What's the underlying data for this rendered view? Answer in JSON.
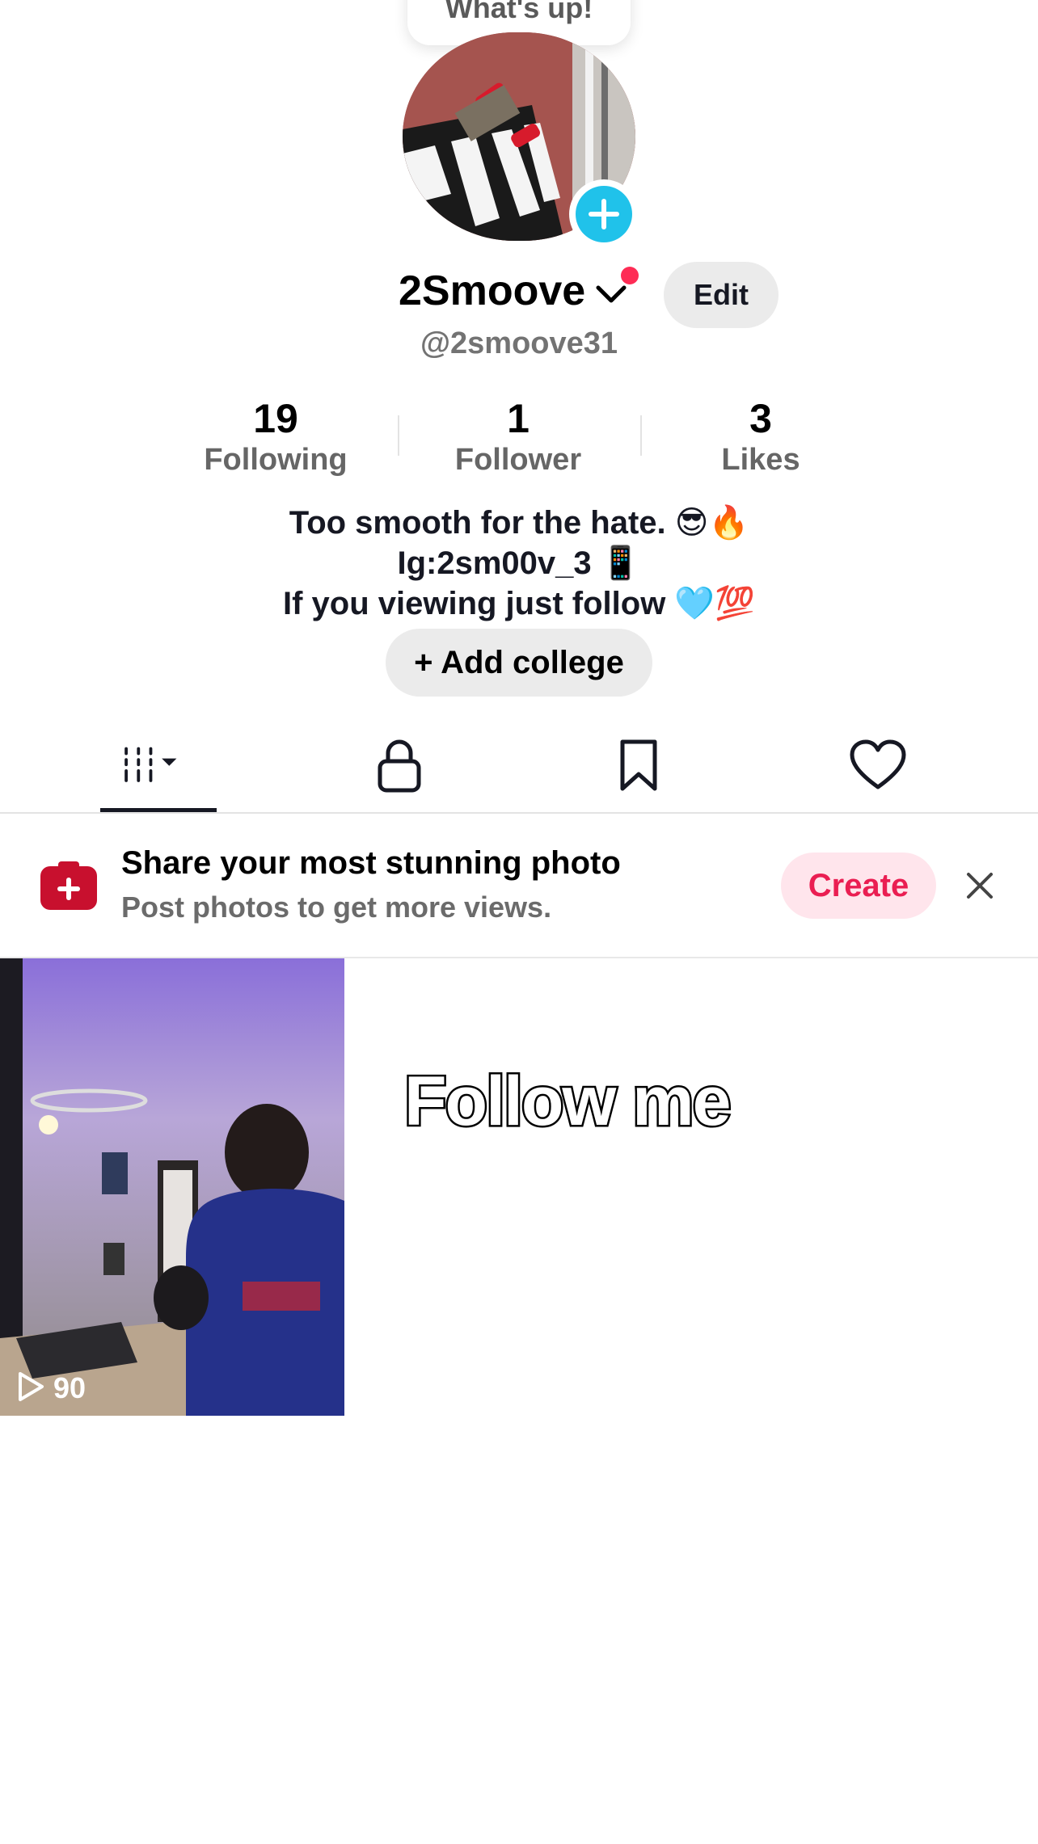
{
  "bubble": {
    "text": "What's up!"
  },
  "profile": {
    "display_name": "2Smoove",
    "username": "@2smoove31",
    "edit_label": "Edit"
  },
  "stats": [
    {
      "value": "19",
      "label": "Following"
    },
    {
      "value": "1",
      "label": "Follower"
    },
    {
      "value": "3",
      "label": "Likes"
    }
  ],
  "bio": {
    "line1": "Too smooth for the hate. 😎🔥",
    "line2": "Ig:2sm00v_3 📱",
    "line3": "If you viewing just follow 🩵💯"
  },
  "add_college_label": "+ Add college",
  "tabs": [
    {
      "icon": "videos-grid-icon",
      "selected": true
    },
    {
      "icon": "lock-icon",
      "selected": false
    },
    {
      "icon": "bookmark-icon",
      "selected": false
    },
    {
      "icon": "heart-icon",
      "selected": false
    }
  ],
  "promo": {
    "title": "Share your most stunning photo",
    "subtitle": "Post photos to get more views.",
    "create_label": "Create"
  },
  "videos": [
    {
      "views": "90"
    }
  ],
  "overlay_text": "Follow me",
  "colors": {
    "accent_red": "#fe2c55",
    "create_text": "#ea1e52",
    "avatar_plus": "#20c2ea"
  }
}
